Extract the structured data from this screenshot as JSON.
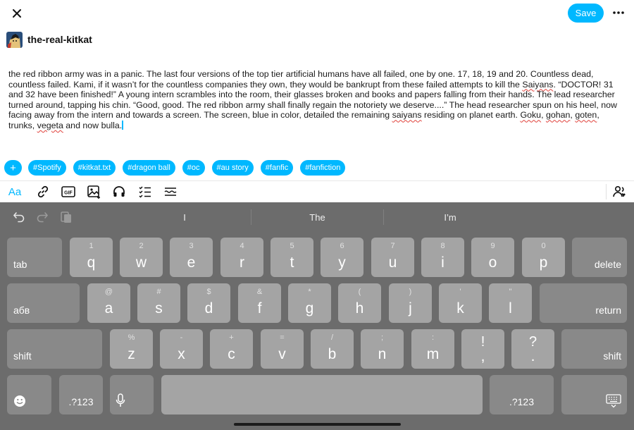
{
  "header": {
    "close_icon": "close-icon",
    "save_label": "Save",
    "more_icon": "more-icon"
  },
  "blog": {
    "name": "the-real-kitkat"
  },
  "post": {
    "segments": [
      "the red ribbon army was in a panic. The last four versions of the top tier artificial humans have all failed, one by one. 17, 18, 19 and 20. Countless dead, countless failed. Kami, if it wasn’t for the countless companies they own, they would be bankrupt from these failed attempts to kill the ",
      "Saiyans",
      ". “DOCTOR! 31 and 32 have been finished!” A young intern scrambles into the room, their glasses broken and books and papers falling from their hands. The lead researcher turned around, tapping his chin. “Good, good. The red ribbon army shall finally regain the notoriety we deserve....” The head researcher spun on his heel, now facing away from the intern and towards a screen. The screen, blue in color, detailed the remaining ",
      "saiyans",
      " residing on planet earth. ",
      "Goku",
      ", ",
      "gohan",
      ", ",
      "goten",
      ", trunks, ",
      "vegeta",
      " and now bulla."
    ]
  },
  "tags": {
    "add_label": "+",
    "items": [
      "#Spotify",
      "#kitkat.txt",
      "#dragon ball",
      "#oc",
      "#au story",
      "#fanfic",
      "#fanfiction"
    ]
  },
  "toolbar": {
    "text_label": "Aa",
    "gif_label": "GIF"
  },
  "keyboard": {
    "suggestions": [
      "I",
      "The",
      "I’m"
    ],
    "row1": {
      "tab": "tab",
      "keys": [
        {
          "main": "q",
          "sub": "1"
        },
        {
          "main": "w",
          "sub": "2"
        },
        {
          "main": "e",
          "sub": "3"
        },
        {
          "main": "r",
          "sub": "4"
        },
        {
          "main": "t",
          "sub": "5"
        },
        {
          "main": "y",
          "sub": "6"
        },
        {
          "main": "u",
          "sub": "7"
        },
        {
          "main": "i",
          "sub": "8"
        },
        {
          "main": "o",
          "sub": "9"
        },
        {
          "main": "p",
          "sub": "0"
        }
      ],
      "delete": "delete"
    },
    "row2": {
      "lang": "абв",
      "keys": [
        {
          "main": "a",
          "sub": "@"
        },
        {
          "main": "s",
          "sub": "#"
        },
        {
          "main": "d",
          "sub": "$"
        },
        {
          "main": "f",
          "sub": "&"
        },
        {
          "main": "g",
          "sub": "*"
        },
        {
          "main": "h",
          "sub": "("
        },
        {
          "main": "j",
          "sub": ")"
        },
        {
          "main": "k",
          "sub": "'"
        },
        {
          "main": "l",
          "sub": "\""
        }
      ],
      "return": "return"
    },
    "row3": {
      "shift": "shift",
      "keys": [
        {
          "main": "z",
          "sub": "%"
        },
        {
          "main": "x",
          "sub": "-"
        },
        {
          "main": "c",
          "sub": "+"
        },
        {
          "main": "v",
          "sub": "="
        },
        {
          "main": "b",
          "sub": "/"
        },
        {
          "main": "n",
          "sub": ";"
        },
        {
          "main": "m",
          "sub": ":"
        },
        {
          "main": ",",
          "sub": "!"
        },
        {
          "main": ".",
          "sub": "?"
        }
      ]
    },
    "row4": {
      "num_left": ".?123",
      "num_right": ".?123"
    }
  },
  "colors": {
    "accent": "#00b8ff",
    "keyboard_bg": "#6c6c6c",
    "key": "#a4a4a4",
    "fn_key": "#898989",
    "squiggle": "#e0403a"
  }
}
